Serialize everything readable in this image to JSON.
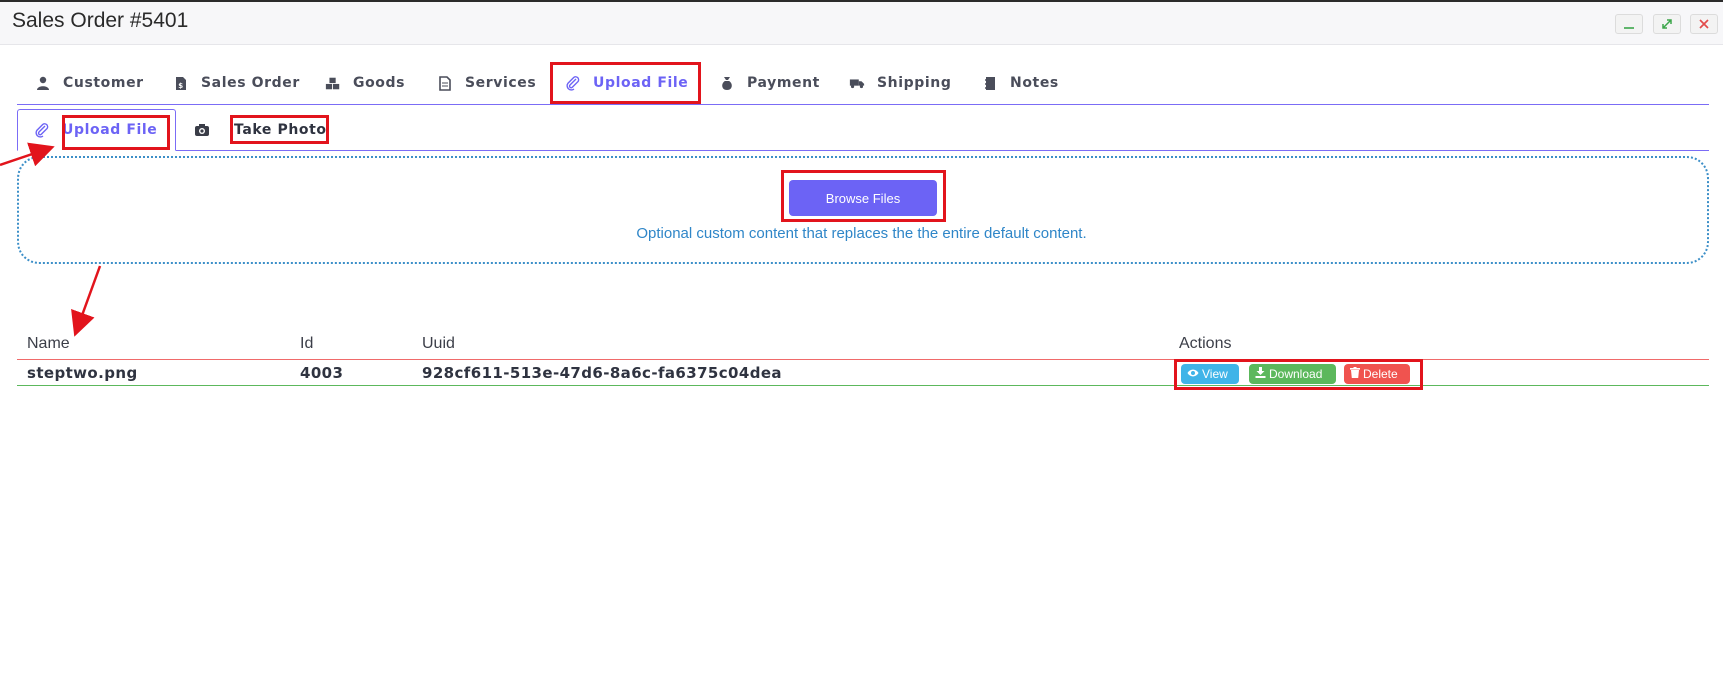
{
  "window": {
    "title": "Sales Order #5401",
    "controls": {
      "minimize_icon": "minimize-icon",
      "maximize_icon": "maximize-icon",
      "close_icon": "close-icon"
    }
  },
  "main_tabs": [
    {
      "label": "Customer",
      "icon": "user-icon"
    },
    {
      "label": "Sales Order",
      "icon": "invoice-icon"
    },
    {
      "label": "Goods",
      "icon": "boxes-icon"
    },
    {
      "label": "Services",
      "icon": "document-icon"
    },
    {
      "label": "Upload File",
      "icon": "paperclip-icon",
      "active": true
    },
    {
      "label": "Payment",
      "icon": "money-bag-icon"
    },
    {
      "label": "Shipping",
      "icon": "truck-icon"
    },
    {
      "label": "Notes",
      "icon": "notebook-icon"
    }
  ],
  "sub_tabs": [
    {
      "label": "Upload File",
      "icon": "paperclip-icon",
      "active": true
    },
    {
      "label": "Take Photo",
      "icon": "camera-icon"
    }
  ],
  "dropzone": {
    "button_label": "Browse Files",
    "text": "Optional custom content that replaces the the entire default content."
  },
  "table": {
    "columns": [
      "Name",
      "Id",
      "Uuid",
      "Actions"
    ],
    "rows": [
      {
        "name": "steptwo.png",
        "id": "4003",
        "uuid": "928cf611-513e-47d6-8a6c-fa6375c04dea"
      }
    ],
    "actions": {
      "view": "View",
      "download": "Download",
      "delete": "Delete"
    }
  },
  "colors": {
    "accent": "#6c63f5",
    "annotation_red": "#e2141c",
    "info": "#40b4e8",
    "success": "#5cb85c",
    "danger": "#f0534f",
    "dropzone_border": "#3c8fc8"
  }
}
